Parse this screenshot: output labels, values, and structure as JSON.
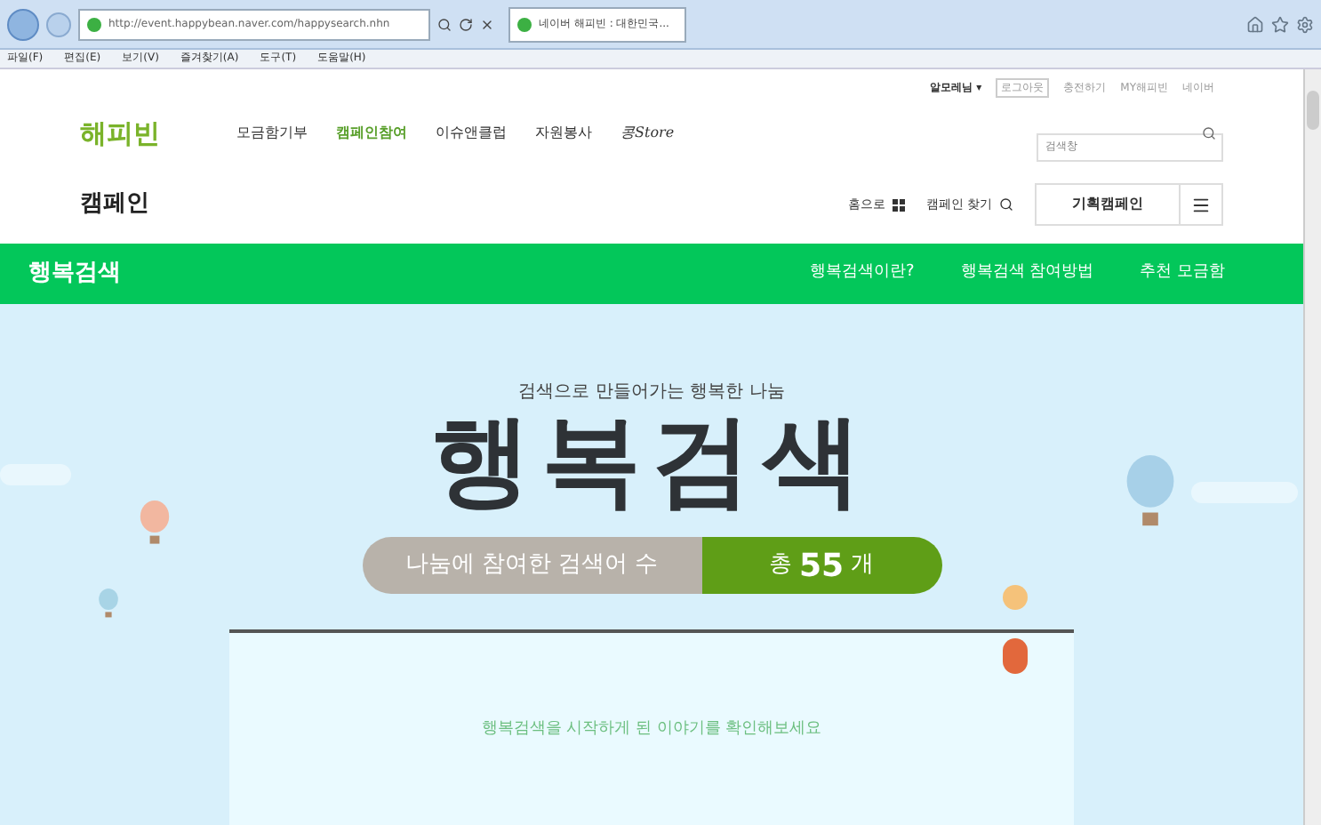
{
  "browser": {
    "address": "http://event.happybean.naver.com/happysearch.nhn",
    "tab_title": "네이버 해피빈 : 대한민국...",
    "menu": [
      "파일(F)",
      "편집(E)",
      "보기(V)",
      "즐겨찾기(A)",
      "도구(T)",
      "도움말(H)"
    ]
  },
  "user_links": [
    {
      "label": "알모레님 ▾",
      "kind": "user"
    },
    {
      "label": "로그아웃",
      "kind": "boxed"
    },
    {
      "label": "충전하기",
      "kind": "plain"
    },
    {
      "label": "MY해피빈",
      "kind": "plain"
    },
    {
      "label": "네이버",
      "kind": "plain"
    }
  ],
  "logo": "해피빈",
  "nav": [
    {
      "label": "모금함기부",
      "selected": false
    },
    {
      "label": "캠페인참여",
      "selected": true
    },
    {
      "label": "이슈앤클럽",
      "selected": false
    },
    {
      "label": "자원봉사",
      "selected": false
    },
    {
      "label": "콩Store",
      "selected": false
    }
  ],
  "search": {
    "placeholder": "검색창"
  },
  "section_title": "캠페인",
  "section_links": [
    {
      "label": "홈으로",
      "kind": "home"
    },
    {
      "label": "캠페인 찾기",
      "kind": "search"
    }
  ],
  "special_button": "기획캠페인",
  "green_bar": {
    "title": "행복검색",
    "links": [
      "행복검색이란?",
      "행복검색 참여방법",
      "추천 모금함"
    ]
  },
  "hero": {
    "subtitle": "검색으로 만들어가는 행복한 나눔",
    "title": "행복검색",
    "counter_label": "나눔에 참여한 검색어 수",
    "counter_prefix": "총",
    "counter_value": "55",
    "counter_suffix": "개",
    "card_text": "행복검색을 시작하게 된 이야기를 확인해보세요"
  }
}
